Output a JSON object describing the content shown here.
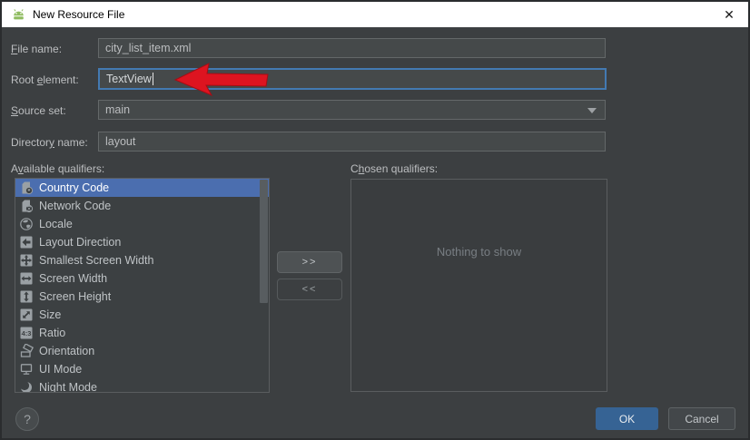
{
  "window": {
    "title": "New Resource File",
    "close_glyph": "✕"
  },
  "colors": {
    "titlebar": "#ffffff",
    "dialog_bg": "#3c3f41",
    "selection": "#4b6eaf",
    "focus_border": "#437ab2",
    "ok_button": "#366394",
    "arrow": "#dd1420"
  },
  "form": {
    "fields": [
      {
        "label": {
          "text": "File name:",
          "mnemonic": "F"
        },
        "value": "city_list_item.xml"
      },
      {
        "label": {
          "text": "Root element:",
          "mnemonic": "e"
        },
        "value": "TextView",
        "focused": true
      },
      {
        "label": {
          "text": "Source set:",
          "mnemonic": "S"
        },
        "value": "main",
        "type": "combo"
      },
      {
        "label": {
          "text": "Directory name:",
          "mnemonic": "y"
        },
        "value": "layout"
      }
    ]
  },
  "qualifiers": {
    "available_label": {
      "text": "Available qualifiers:",
      "mnemonic": "v"
    },
    "chosen_label": {
      "text": "Chosen qualifiers:",
      "mnemonic": "h"
    },
    "available": [
      {
        "label": "Country Code",
        "icon": "country-code-icon",
        "selected": true
      },
      {
        "label": "Network Code",
        "icon": "network-code-icon"
      },
      {
        "label": "Locale",
        "icon": "locale-icon"
      },
      {
        "label": "Layout Direction",
        "icon": "layout-direction-icon"
      },
      {
        "label": "Smallest Screen Width",
        "icon": "smallest-screen-width-icon"
      },
      {
        "label": "Screen Width",
        "icon": "screen-width-icon"
      },
      {
        "label": "Screen Height",
        "icon": "screen-height-icon"
      },
      {
        "label": "Size",
        "icon": "size-icon"
      },
      {
        "label": "Ratio",
        "icon": "ratio-icon"
      },
      {
        "label": "Orientation",
        "icon": "orientation-icon"
      },
      {
        "label": "UI Mode",
        "icon": "ui-mode-icon"
      },
      {
        "label": "Night Mode",
        "icon": "night-mode-icon"
      }
    ],
    "add_button": ">>",
    "remove_button": "<<",
    "chosen_empty": "Nothing to show"
  },
  "footer": {
    "help": "?",
    "ok": "OK",
    "cancel": "Cancel"
  }
}
